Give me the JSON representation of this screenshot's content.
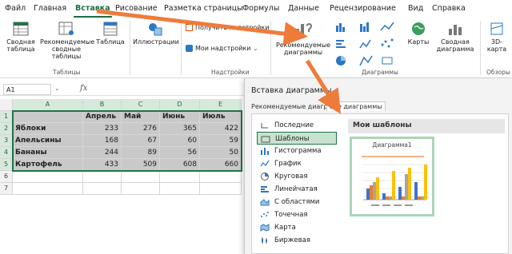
{
  "tabs": [
    "Файл",
    "Главная",
    "Вставка",
    "Рисование",
    "Разметка страницы",
    "Формулы",
    "Данные",
    "Рецензирование",
    "Вид",
    "Справка"
  ],
  "active_tab": "Вставка",
  "ribbon": {
    "pivot_table": "Сводная таблица",
    "recommended_pivot": "Рекомендуемые сводные таблицы",
    "table": "Таблица",
    "group_tables": "Таблицы",
    "illustrations": "Иллюстрации",
    "get_addins": "Получить надстройки",
    "my_addins": "Мои надстройки",
    "group_addins": "Надстройки",
    "recommended_charts": "Рекомендуемые диаграммы",
    "group_charts": "Диаграммы",
    "maps": "Карты",
    "pivot_chart": "Сводная диаграмма",
    "map_3d": "3D-карта",
    "group_tours": "Обзоры"
  },
  "formula_bar": {
    "name_box": "A1",
    "fx": "fx"
  },
  "sheet": {
    "columns": [
      "A",
      "B",
      "C",
      "D",
      "E"
    ],
    "rows": [
      "1",
      "2",
      "3",
      "4",
      "5",
      "6",
      "7"
    ],
    "header": [
      "",
      "Апрель",
      "Май",
      "Июнь",
      "Июль"
    ],
    "data": [
      [
        "Яблоки",
        "233",
        "276",
        "365",
        "422"
      ],
      [
        "Апельсины",
        "168",
        "67",
        "60",
        "59"
      ],
      [
        "Бананы",
        "244",
        "89",
        "56",
        "50"
      ],
      [
        "Картофель",
        "433",
        "509",
        "608",
        "660"
      ]
    ]
  },
  "dialog": {
    "title": "Вставка диаграммы",
    "tab_recommended": "Рекомендуемые диаграммы",
    "tab_all": "Все диаграммы",
    "chart_types": [
      "Последние",
      "Шаблоны",
      "Гистограмма",
      "График",
      "Круговая",
      "Линейчатая",
      "С областями",
      "Точечная",
      "Карта",
      "Биржевая"
    ],
    "selected_type": "Шаблоны",
    "templates_header": "Мои шаблоны",
    "template_name": "Диаграмма1"
  },
  "colors": {
    "accent": "#217346",
    "arrow": "#ef7b3a"
  }
}
